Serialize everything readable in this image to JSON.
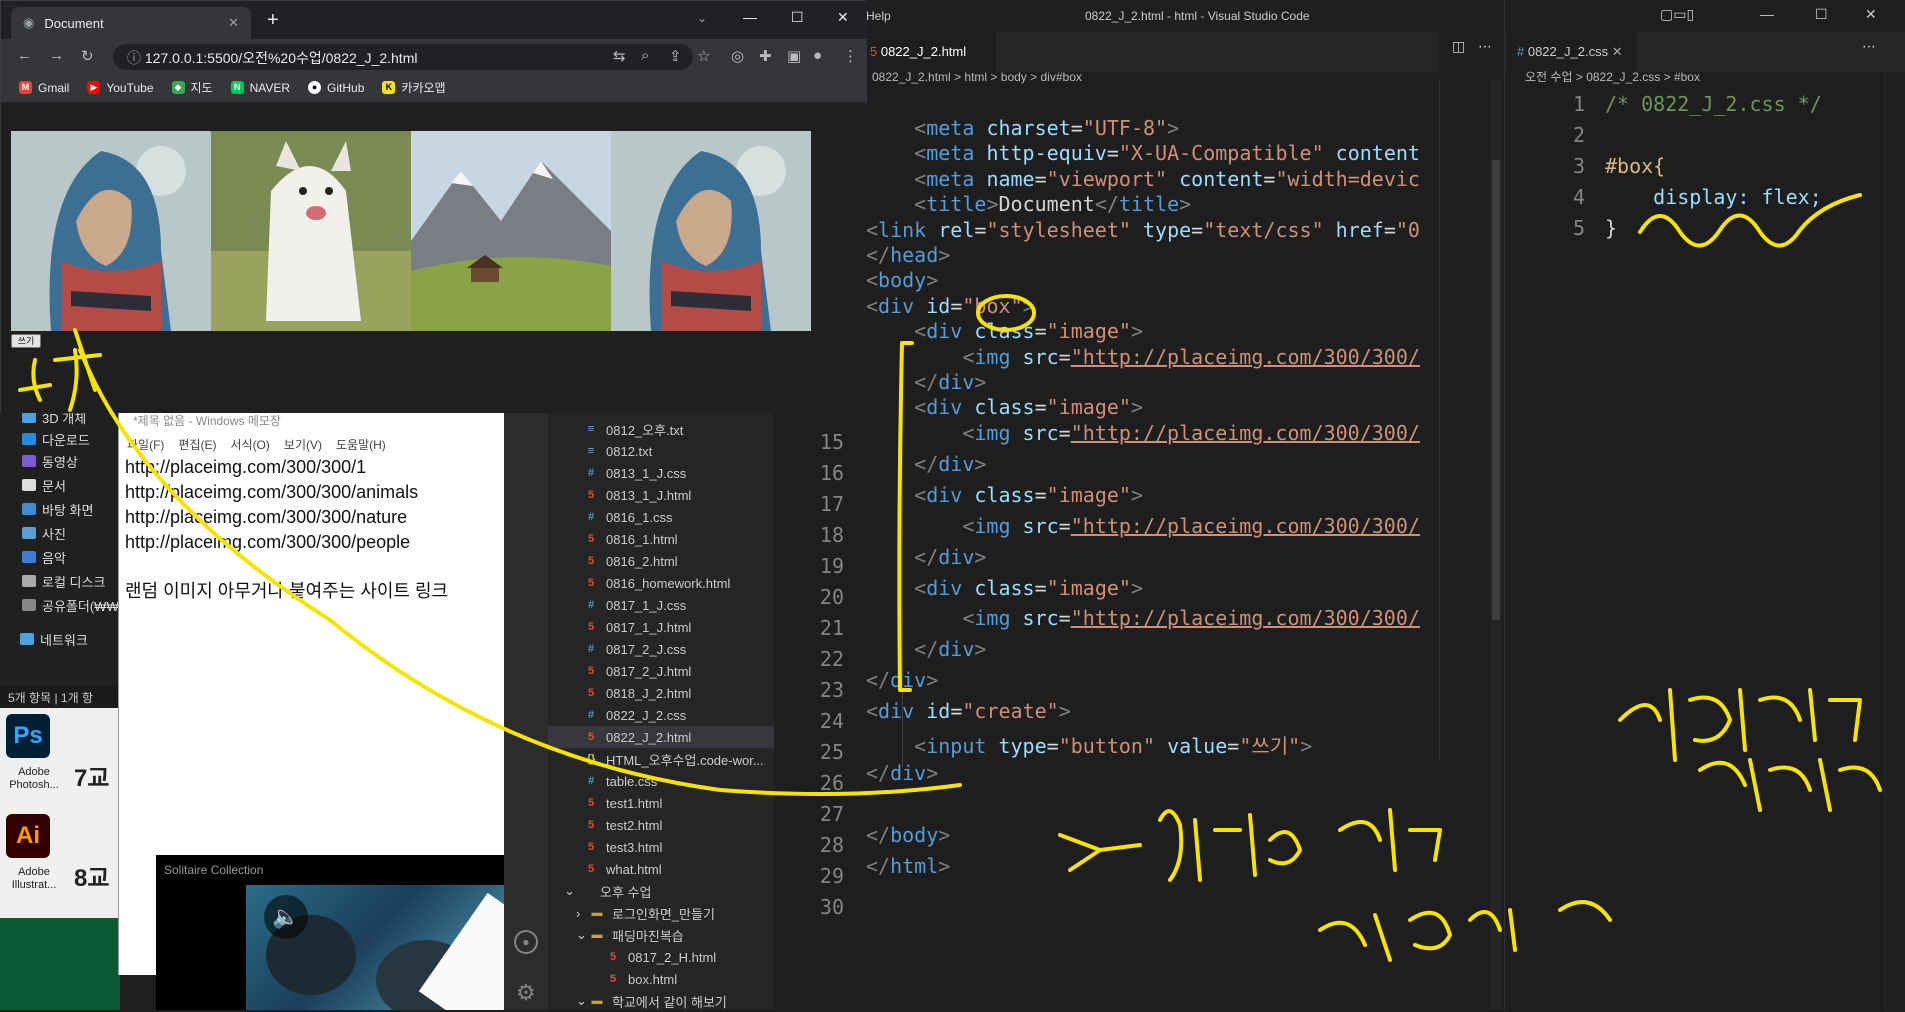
{
  "browser": {
    "tab_title": "Document",
    "url": "127.0.0.1:5500/오전%20수업/0822_J_2.html",
    "bookmarks": [
      "Gmail",
      "YouTube",
      "지도",
      "NAVER",
      "GitHub",
      "카카오맵"
    ],
    "write_button": "쓰기",
    "images": [
      "woman-in-scarf",
      "white-dog",
      "mountain-cabin",
      "woman-in-scarf"
    ]
  },
  "vscode_title": "0822_J_2.html - html - Visual Studio Code",
  "vscode_help": "Help",
  "editor_left": {
    "tab": "0822_J_2.html",
    "breadcrumb": [
      "0822_J_2.html",
      "html",
      "body",
      "div#box"
    ],
    "visible_start_line": 15,
    "line_numbers": [
      15,
      16,
      17,
      18,
      19,
      20,
      21,
      22,
      23,
      24,
      25,
      26,
      27,
      28,
      29,
      30
    ],
    "image_url": "http://placeimg.com/300/300/"
  },
  "explorer_files": [
    {
      "name": "0812_오후.txt",
      "type": "txt"
    },
    {
      "name": "0812.txt",
      "type": "txt"
    },
    {
      "name": "0813_1_J.css",
      "type": "css"
    },
    {
      "name": "0813_1_J.html",
      "type": "html"
    },
    {
      "name": "0816_1.css",
      "type": "css"
    },
    {
      "name": "0816_1.html",
      "type": "html"
    },
    {
      "name": "0816_2.html",
      "type": "html"
    },
    {
      "name": "0816_homework.html",
      "type": "html"
    },
    {
      "name": "0817_1_J.css",
      "type": "css"
    },
    {
      "name": "0817_1_J.html",
      "type": "html"
    },
    {
      "name": "0817_2_J.css",
      "type": "css"
    },
    {
      "name": "0817_2_J.html",
      "type": "html"
    },
    {
      "name": "0818_J_2.html",
      "type": "html"
    },
    {
      "name": "0822_J_2.css",
      "type": "css"
    },
    {
      "name": "0822_J_2.html",
      "type": "html"
    },
    {
      "name": "HTML_오후수업.code-wor...",
      "type": "json"
    },
    {
      "name": "table.css",
      "type": "css"
    },
    {
      "name": "test1.html",
      "type": "html"
    },
    {
      "name": "test2.html",
      "type": "html"
    },
    {
      "name": "test3.html",
      "type": "html"
    },
    {
      "name": "what.html",
      "type": "html"
    }
  ],
  "explorer_folders": [
    "오후 수업",
    "로그인화면_만들기",
    "패딩마진복습",
    "0817_2_H.html",
    "box.html",
    "학교에서 같이 해보기"
  ],
  "editor_right": {
    "tab": "0822_J_2.css",
    "breadcrumb": [
      "오전 수업",
      "0822_J_2.css",
      "#box"
    ],
    "lines": [
      "/* 0822_J_2.css */",
      "",
      "#box{",
      "    display: flex;",
      "}"
    ]
  },
  "notepad": {
    "title": "*제목 없음 - Windows 메모장",
    "menu": [
      "파일(F)",
      "편집(E)",
      "서식(O)",
      "보기(V)",
      "도움말(H)"
    ],
    "lines": [
      "http://placeimg.com/300/300/1",
      "http://placeimg.com/300/300/animals",
      "http://placeimg.com/300/300/nature",
      "http://placeimg.com/300/300/people",
      "",
      "랜덤 이미지 아무거나 붙여주는 사이트 링크"
    ]
  },
  "file_explorer": {
    "items": [
      "3D 개체",
      "다운로드",
      "동영상",
      "문서",
      "바탕 화면",
      "사진",
      "음악",
      "로컬 디스크",
      "공유폴더(₩₩"
    ],
    "network": "네트워크",
    "status": "5개 항목  |  1개 항"
  },
  "desktop": {
    "apps": [
      {
        "short": "Ps",
        "label": "Adobe Photosh...",
        "color": "#31a8ff",
        "bg": "#001e36"
      },
      {
        "short": "Ai",
        "label": "Adobe Illustrat...",
        "color": "#ff9a00",
        "bg": "#330000"
      }
    ],
    "schedule": [
      "7교",
      "8교"
    ]
  },
  "solitaire_title": "Solitaire Collection",
  "colors": {
    "annotation": "#f5e400",
    "accent": "#007acc"
  }
}
